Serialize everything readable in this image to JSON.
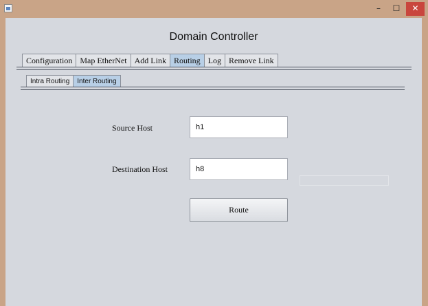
{
  "window": {
    "minimize_glyph": "–",
    "maximize_glyph": "☐",
    "close_glyph": "✕"
  },
  "app": {
    "title": "Domain Controller"
  },
  "tabs": [
    {
      "label": "Configuration"
    },
    {
      "label": "Map EtherNet"
    },
    {
      "label": "Add Link"
    },
    {
      "label": "Routing",
      "active": true
    },
    {
      "label": "Log"
    },
    {
      "label": "Remove Link"
    }
  ],
  "subtabs": [
    {
      "label": "Intra Routing"
    },
    {
      "label": "Inter Routing",
      "active": true
    }
  ],
  "form": {
    "source_label": "Source Host",
    "source_value": "h1",
    "destination_label": "Destination Host",
    "destination_value": "h8",
    "route_label": "Route"
  },
  "colors": {
    "titlebar": "#c9a487",
    "client": "#d5d8de",
    "active_tab": "#b8cfe6",
    "close_button": "#c9463d"
  }
}
